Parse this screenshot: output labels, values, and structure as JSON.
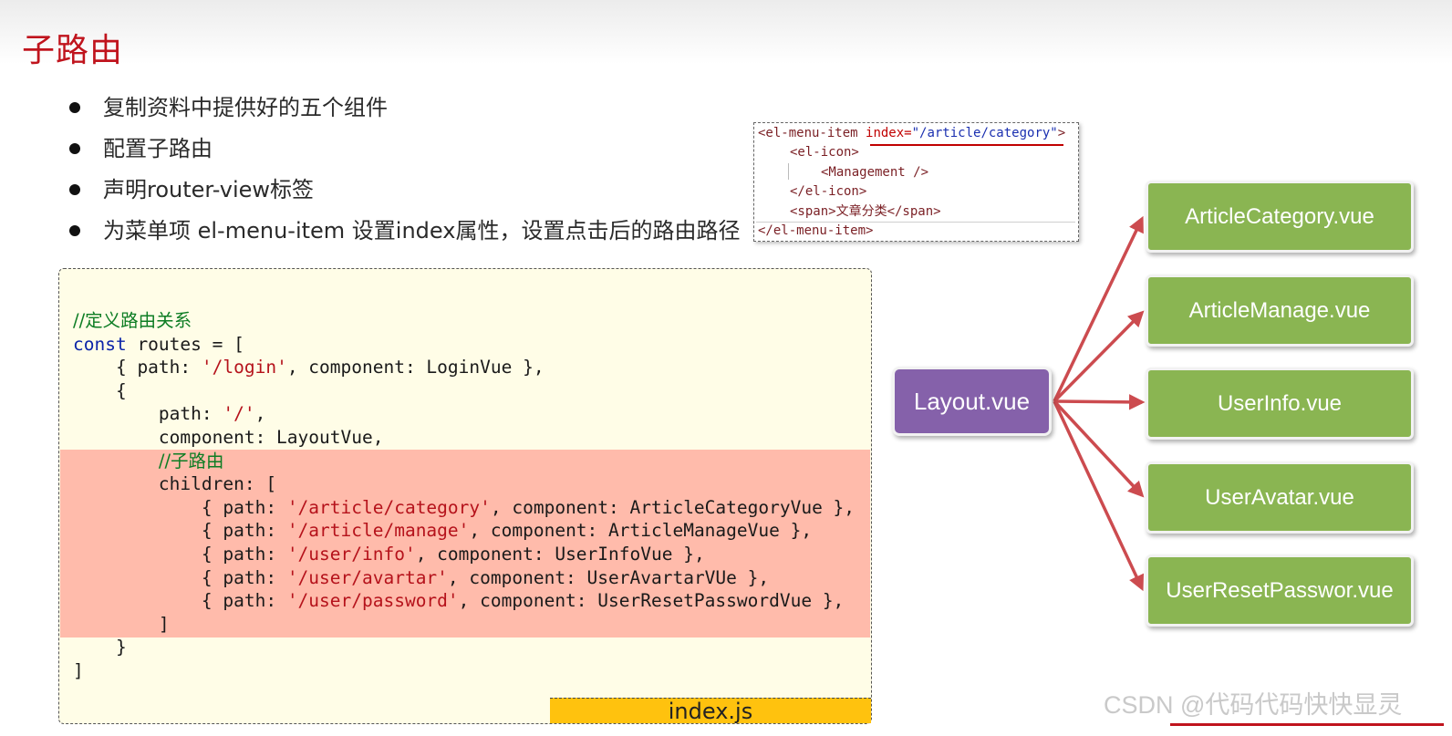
{
  "slide": {
    "title": "子路由",
    "bullets": [
      "复制资料中提供好的五个组件",
      "配置子路由",
      "声明router-view标签",
      "为菜单项 el-menu-item 设置index属性，设置点击后的路由路径"
    ]
  },
  "snippet": {
    "line1_tag_open": "<el-menu-item ",
    "line1_attr": "index=",
    "line1_value": "\"/article/category\"",
    "line1_end": ">",
    "line2": "<el-icon>",
    "line3": "<Management />",
    "line4": "</el-icon>",
    "line5": "<span>文章分类</span>",
    "line6": "</el-menu-item>"
  },
  "code": {
    "comment1": "//定义路由关系",
    "kw_const": "const",
    "routes_open": " routes = [",
    "login_pre": "    { path: ",
    "login_path": "'/login'",
    "login_post": ", component: LoginVue },",
    "brace_open": "    {",
    "root_pre": "        path: ",
    "root_path": "'/'",
    "root_post": ",",
    "component_layout": "        component: LayoutVue,",
    "comment2": "//子路由",
    "children_open": "        children: [",
    "child_pre": "            { path: ",
    "children": [
      {
        "path": "'/article/category'",
        "post": ", component: ArticleCategoryVue },"
      },
      {
        "path": "'/article/manage'",
        "post": ", component: ArticleManageVue },"
      },
      {
        "path": "'/user/info'",
        "post": ", component: UserInfoVue },"
      },
      {
        "path": "'/user/avartar'",
        "post": ", component: UserAvartarVUe },"
      },
      {
        "path": "'/user/password'",
        "post": ", component: UserResetPasswordVue },"
      }
    ],
    "children_close": "        ]",
    "brace_close": "    }",
    "routes_close": "]",
    "file_label": "index.js"
  },
  "diagram": {
    "parent": "Layout.vue",
    "children": [
      "ArticleCategory.vue",
      "ArticleManage.vue",
      "UserInfo.vue",
      "UserAvatar.vue",
      "UserResetPasswor.vue"
    ],
    "arrow_color": "#cc4b4f"
  },
  "watermark": "CSDN @代码代码快快显灵",
  "colors": {
    "title": "#c0141d",
    "layout_node": "#8561aa",
    "vue_node": "#8ab552",
    "code_bg": "#fffde7",
    "highlight_bg": "#ffbbab",
    "file_tab": "#ffc20e"
  }
}
